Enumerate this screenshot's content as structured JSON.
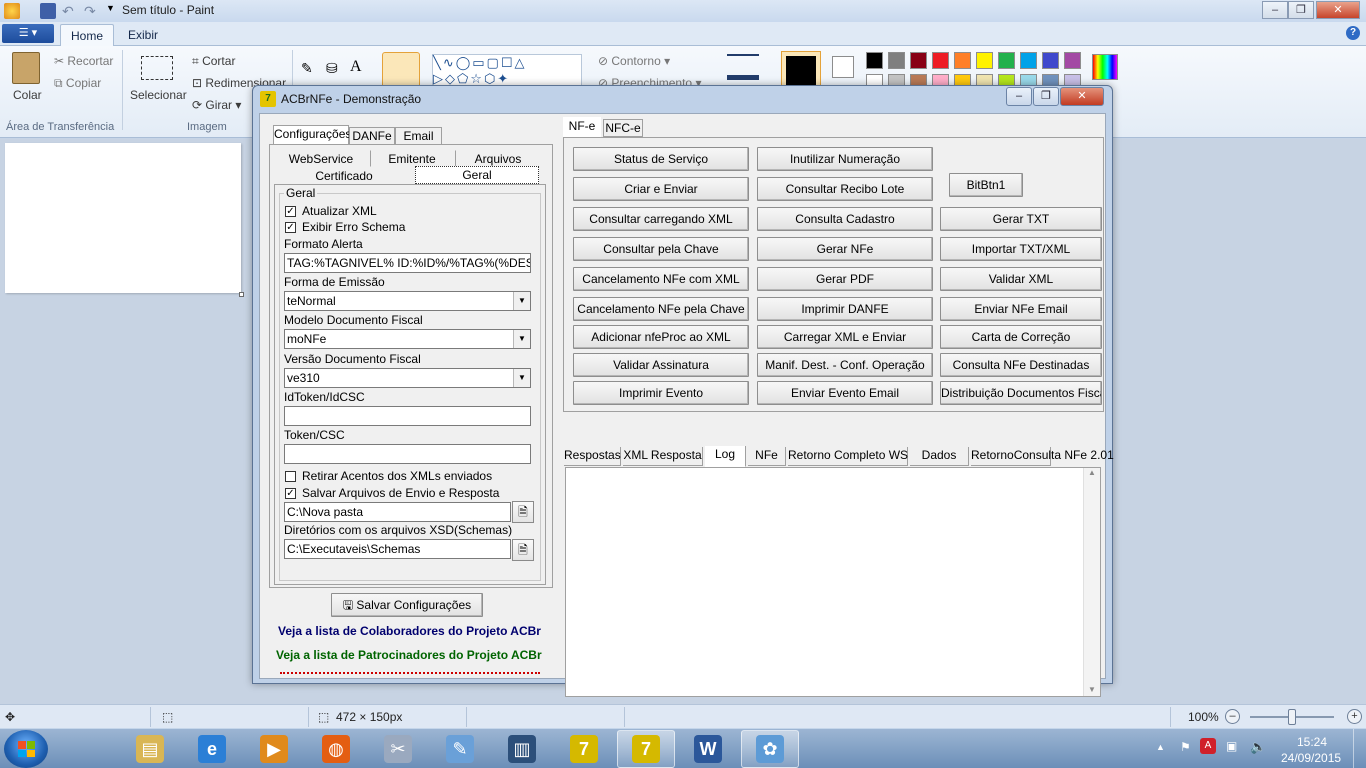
{
  "paint": {
    "title": "Sem título - Paint",
    "tabs": [
      "Home",
      "Exibir"
    ],
    "ribbon": {
      "clipboard": {
        "paste": "Colar",
        "cut": "Recortar",
        "copy": "Copiar",
        "group": "Área de Transferência"
      },
      "image": {
        "select": "Selecionar",
        "crop": "Cortar",
        "resize": "Redimensionar",
        "rotate": "Girar",
        "group": "Imagem"
      },
      "shapes": {
        "outline": "Contorno",
        "fill": "Preenchimento"
      }
    },
    "palette": [
      "#000000",
      "#7f7f7f",
      "#880015",
      "#ed1c24",
      "#ff7f27",
      "#fff200",
      "#22b14c",
      "#00a2e8",
      "#3f48cc",
      "#a349a4",
      "#ffffff",
      "#c3c3c3",
      "#b97a57",
      "#ffaec9",
      "#ffc90e",
      "#efe4b0",
      "#b5e61d",
      "#99d9ea",
      "#7092be",
      "#c8bfe7"
    ],
    "status": {
      "size": "472 × 150px",
      "zoom": "100%"
    }
  },
  "dialog": {
    "title": "ACBrNFe - Demonstração",
    "left": {
      "top_tabs": [
        "Configurações",
        "DANFe",
        "Email"
      ],
      "sub_tabs_row1": [
        "WebService",
        "Emitente",
        "Arquivos"
      ],
      "sub_tabs_row2": [
        "Certificado",
        "Geral"
      ],
      "group_title": "Geral",
      "chk_atualizar_xml": "Atualizar XML",
      "chk_exibir_erro": "Exibir Erro Schema",
      "lbl_formato_alerta": "Formato Alerta",
      "formato_alerta_value": "TAG:%TAGNIVEL% ID:%ID%/%TAG%(%DESCRICAO%)",
      "lbl_forma_emissao": "Forma de Emissão",
      "forma_emissao_value": "teNormal",
      "lbl_modelo": "Modelo Documento Fiscal",
      "modelo_value": "moNFe",
      "lbl_versao": "Versão Documento Fiscal",
      "versao_value": "ve310",
      "lbl_idtoken": "IdToken/IdCSC",
      "idtoken_value": "",
      "lbl_token": "Token/CSC",
      "token_value": "",
      "chk_retirar_acentos": "Retirar Acentos dos XMLs enviados",
      "chk_salvar_arquivos": "Salvar Arquivos de Envio e Resposta",
      "path_salvar": "C:\\Nova pasta",
      "lbl_diretorios": "Diretórios com os arquivos XSD(Schemas)",
      "path_schemas": "C:\\Executaveis\\Schemas",
      "save_button": "Salvar Configurações",
      "link_colaboradores": "Veja a lista de Colaboradores do Projeto ACBr",
      "link_patrocinadores": "Veja a lista de Patrocinadores do Projeto ACBr"
    },
    "right": {
      "tabs": [
        "NF-e",
        "NFC-e"
      ],
      "buttons_col1": [
        "Status de Serviço",
        "Criar e Enviar",
        "Consultar carregando XML",
        "Consultar pela Chave",
        "Cancelamento NFe com XML",
        "Cancelamento NFe pela Chave",
        "Adicionar nfeProc ao XML",
        "Validar Assinatura",
        "Imprimir Evento"
      ],
      "buttons_col2": [
        "Inutilizar Numeração",
        "Consultar Recibo Lote",
        "Consulta Cadastro",
        "Gerar NFe",
        "Gerar PDF",
        "Imprimir DANFE",
        "Carregar XML e Enviar",
        "Manif. Dest. - Conf. Operação",
        "Enviar Evento Email"
      ],
      "bitbtn": "BitBtn1",
      "buttons_col3": [
        "Gerar TXT",
        "Importar TXT/XML",
        "Validar XML",
        "Enviar NFe Email",
        "Carta de Correção",
        "Consulta NFe Destinadas",
        "Distribuição Documentos Fiscais"
      ],
      "result_tabs": [
        "Respostas",
        "XML Resposta",
        "Log",
        "NFe",
        "Retorno Completo WS",
        "Dados",
        "RetornoConsulta NFe 2.01"
      ],
      "selected_result_tab": "Log"
    }
  },
  "taskbar": {
    "items": [
      "explorer",
      "internet-explorer",
      "media-player",
      "firefox",
      "tools",
      "notepad",
      "network-app",
      "acbr-7",
      "acbr-nfe",
      "word",
      "paint"
    ],
    "time": "15:24",
    "date": "24/09/2015"
  }
}
